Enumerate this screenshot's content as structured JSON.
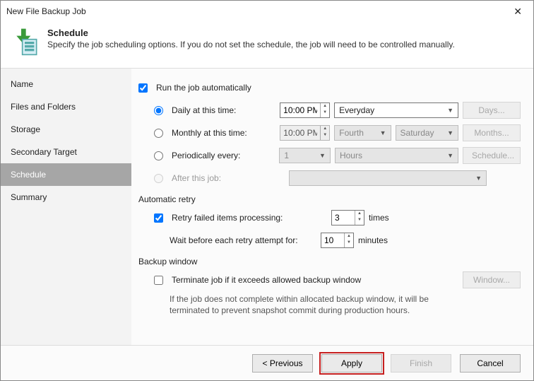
{
  "title": "New File Backup Job",
  "header": {
    "title": "Schedule",
    "subtitle": "Specify the job scheduling options. If you do not set the schedule, the job will need to be controlled manually."
  },
  "sidebar": {
    "items": [
      {
        "label": "Name"
      },
      {
        "label": "Files and Folders"
      },
      {
        "label": "Storage"
      },
      {
        "label": "Secondary Target"
      },
      {
        "label": "Schedule"
      },
      {
        "label": "Summary"
      }
    ]
  },
  "main": {
    "run_auto_label": "Run the job automatically",
    "daily_label": "Daily at this time:",
    "daily_time": "10:00 PM",
    "daily_recur": "Everyday",
    "days_btn": "Days...",
    "monthly_label": "Monthly at this time:",
    "monthly_time": "10:00 PM",
    "monthly_ord": "Fourth",
    "monthly_day": "Saturday",
    "months_btn": "Months...",
    "periodic_label": "Periodically every:",
    "periodic_val": "1",
    "periodic_unit": "Hours",
    "schedule_btn": "Schedule...",
    "after_label": "After this job:",
    "retry_section": "Automatic retry",
    "retry_label": "Retry failed items processing:",
    "retry_count": "3",
    "retry_unit": "times",
    "wait_label": "Wait before each retry attempt for:",
    "wait_val": "10",
    "wait_unit": "minutes",
    "window_section": "Backup window",
    "terminate_label": "Terminate job if it exceeds allowed backup window",
    "window_btn": "Window...",
    "terminate_note": "If the job does not complete within allocated backup window, it will be terminated to prevent snapshot commit during production hours."
  },
  "footer": {
    "previous": "< Previous",
    "apply": "Apply",
    "finish": "Finish",
    "cancel": "Cancel"
  }
}
